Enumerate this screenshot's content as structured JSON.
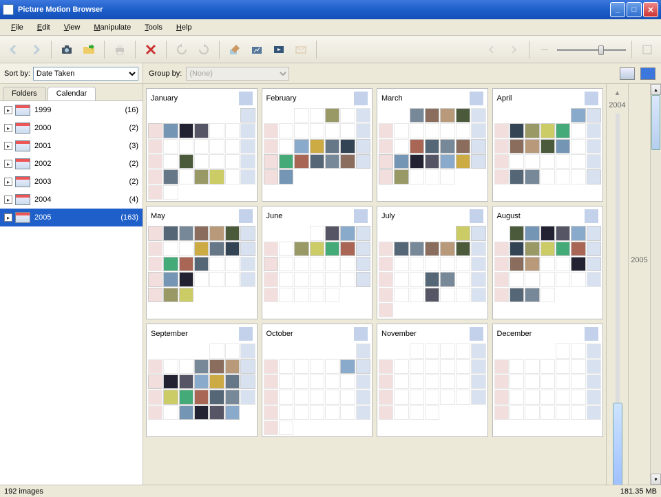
{
  "window": {
    "title": "Picture Motion Browser"
  },
  "menu": {
    "file": "File",
    "edit": "Edit",
    "view": "View",
    "manipulate": "Manipulate",
    "tools": "Tools",
    "help": "Help"
  },
  "sortby": {
    "label": "Sort by:",
    "value": "Date Taken"
  },
  "tabs": {
    "folders": "Folders",
    "calendar": "Calendar"
  },
  "years": [
    {
      "year": "1999",
      "count": "(16)",
      "selected": false
    },
    {
      "year": "2000",
      "count": "(2)",
      "selected": false
    },
    {
      "year": "2001",
      "count": "(3)",
      "selected": false
    },
    {
      "year": "2002",
      "count": "(2)",
      "selected": false
    },
    {
      "year": "2003",
      "count": "(2)",
      "selected": false
    },
    {
      "year": "2004",
      "count": "(4)",
      "selected": false
    },
    {
      "year": "2005",
      "count": "(163)",
      "selected": true
    }
  ],
  "groupby": {
    "label": "Group by:",
    "value": "(None)"
  },
  "timeline": {
    "prev": "2004",
    "current": "2005"
  },
  "months": [
    {
      "name": "January",
      "offset": 6,
      "days": 31,
      "thumbs": [
        1,
        2,
        3,
        4,
        5,
        18,
        24,
        26,
        27
      ]
    },
    {
      "name": "February",
      "offset": 2,
      "days": 28,
      "thumbs": [
        3,
        15,
        16,
        17,
        18,
        19,
        20,
        21,
        22,
        23,
        24,
        25,
        26,
        27,
        28
      ]
    },
    {
      "name": "March",
      "offset": 2,
      "days": 31,
      "thumbs": [
        1,
        2,
        3,
        4,
        15,
        16,
        17,
        18,
        19,
        20,
        21,
        22,
        23,
        24,
        25,
        26,
        27,
        28
      ]
    },
    {
      "name": "April",
      "offset": 5,
      "days": 30,
      "thumbs": [
        1,
        2,
        4,
        5,
        6,
        7,
        11,
        12,
        13,
        14,
        25,
        26,
        30
      ]
    },
    {
      "name": "May",
      "offset": 0,
      "days": 31,
      "thumbs": [
        1,
        2,
        3,
        4,
        5,
        6,
        7,
        11,
        12,
        13,
        14,
        16,
        17,
        18,
        22,
        23,
        24,
        29,
        30,
        31
      ]
    },
    {
      "name": "June",
      "offset": 3,
      "days": 30,
      "thumbs": [
        2,
        3,
        4,
        7,
        8,
        9,
        10,
        11,
        12,
        18,
        25
      ]
    },
    {
      "name": "July",
      "offset": 5,
      "days": 31,
      "thumbs": [
        1,
        2,
        4,
        5,
        6,
        7,
        8,
        20,
        21,
        27
      ]
    },
    {
      "name": "August",
      "offset": 1,
      "days": 31,
      "thumbs": [
        1,
        2,
        3,
        4,
        5,
        6,
        8,
        9,
        10,
        11,
        12,
        13,
        15,
        16,
        19,
        20,
        29,
        30
      ]
    },
    {
      "name": "September",
      "offset": 4,
      "days": 30,
      "thumbs": [
        7,
        8,
        9,
        10,
        11,
        12,
        13,
        14,
        15,
        16,
        17,
        19,
        20,
        21,
        22,
        23,
        27,
        28,
        29,
        30
      ]
    },
    {
      "name": "October",
      "offset": 6,
      "days": 31,
      "thumbs": [
        7,
        8
      ]
    },
    {
      "name": "November",
      "offset": 2,
      "days": 30,
      "thumbs": []
    },
    {
      "name": "December",
      "offset": 4,
      "days": 31,
      "thumbs": []
    }
  ],
  "status": {
    "count": "192 images",
    "size": "181.35 MB"
  }
}
